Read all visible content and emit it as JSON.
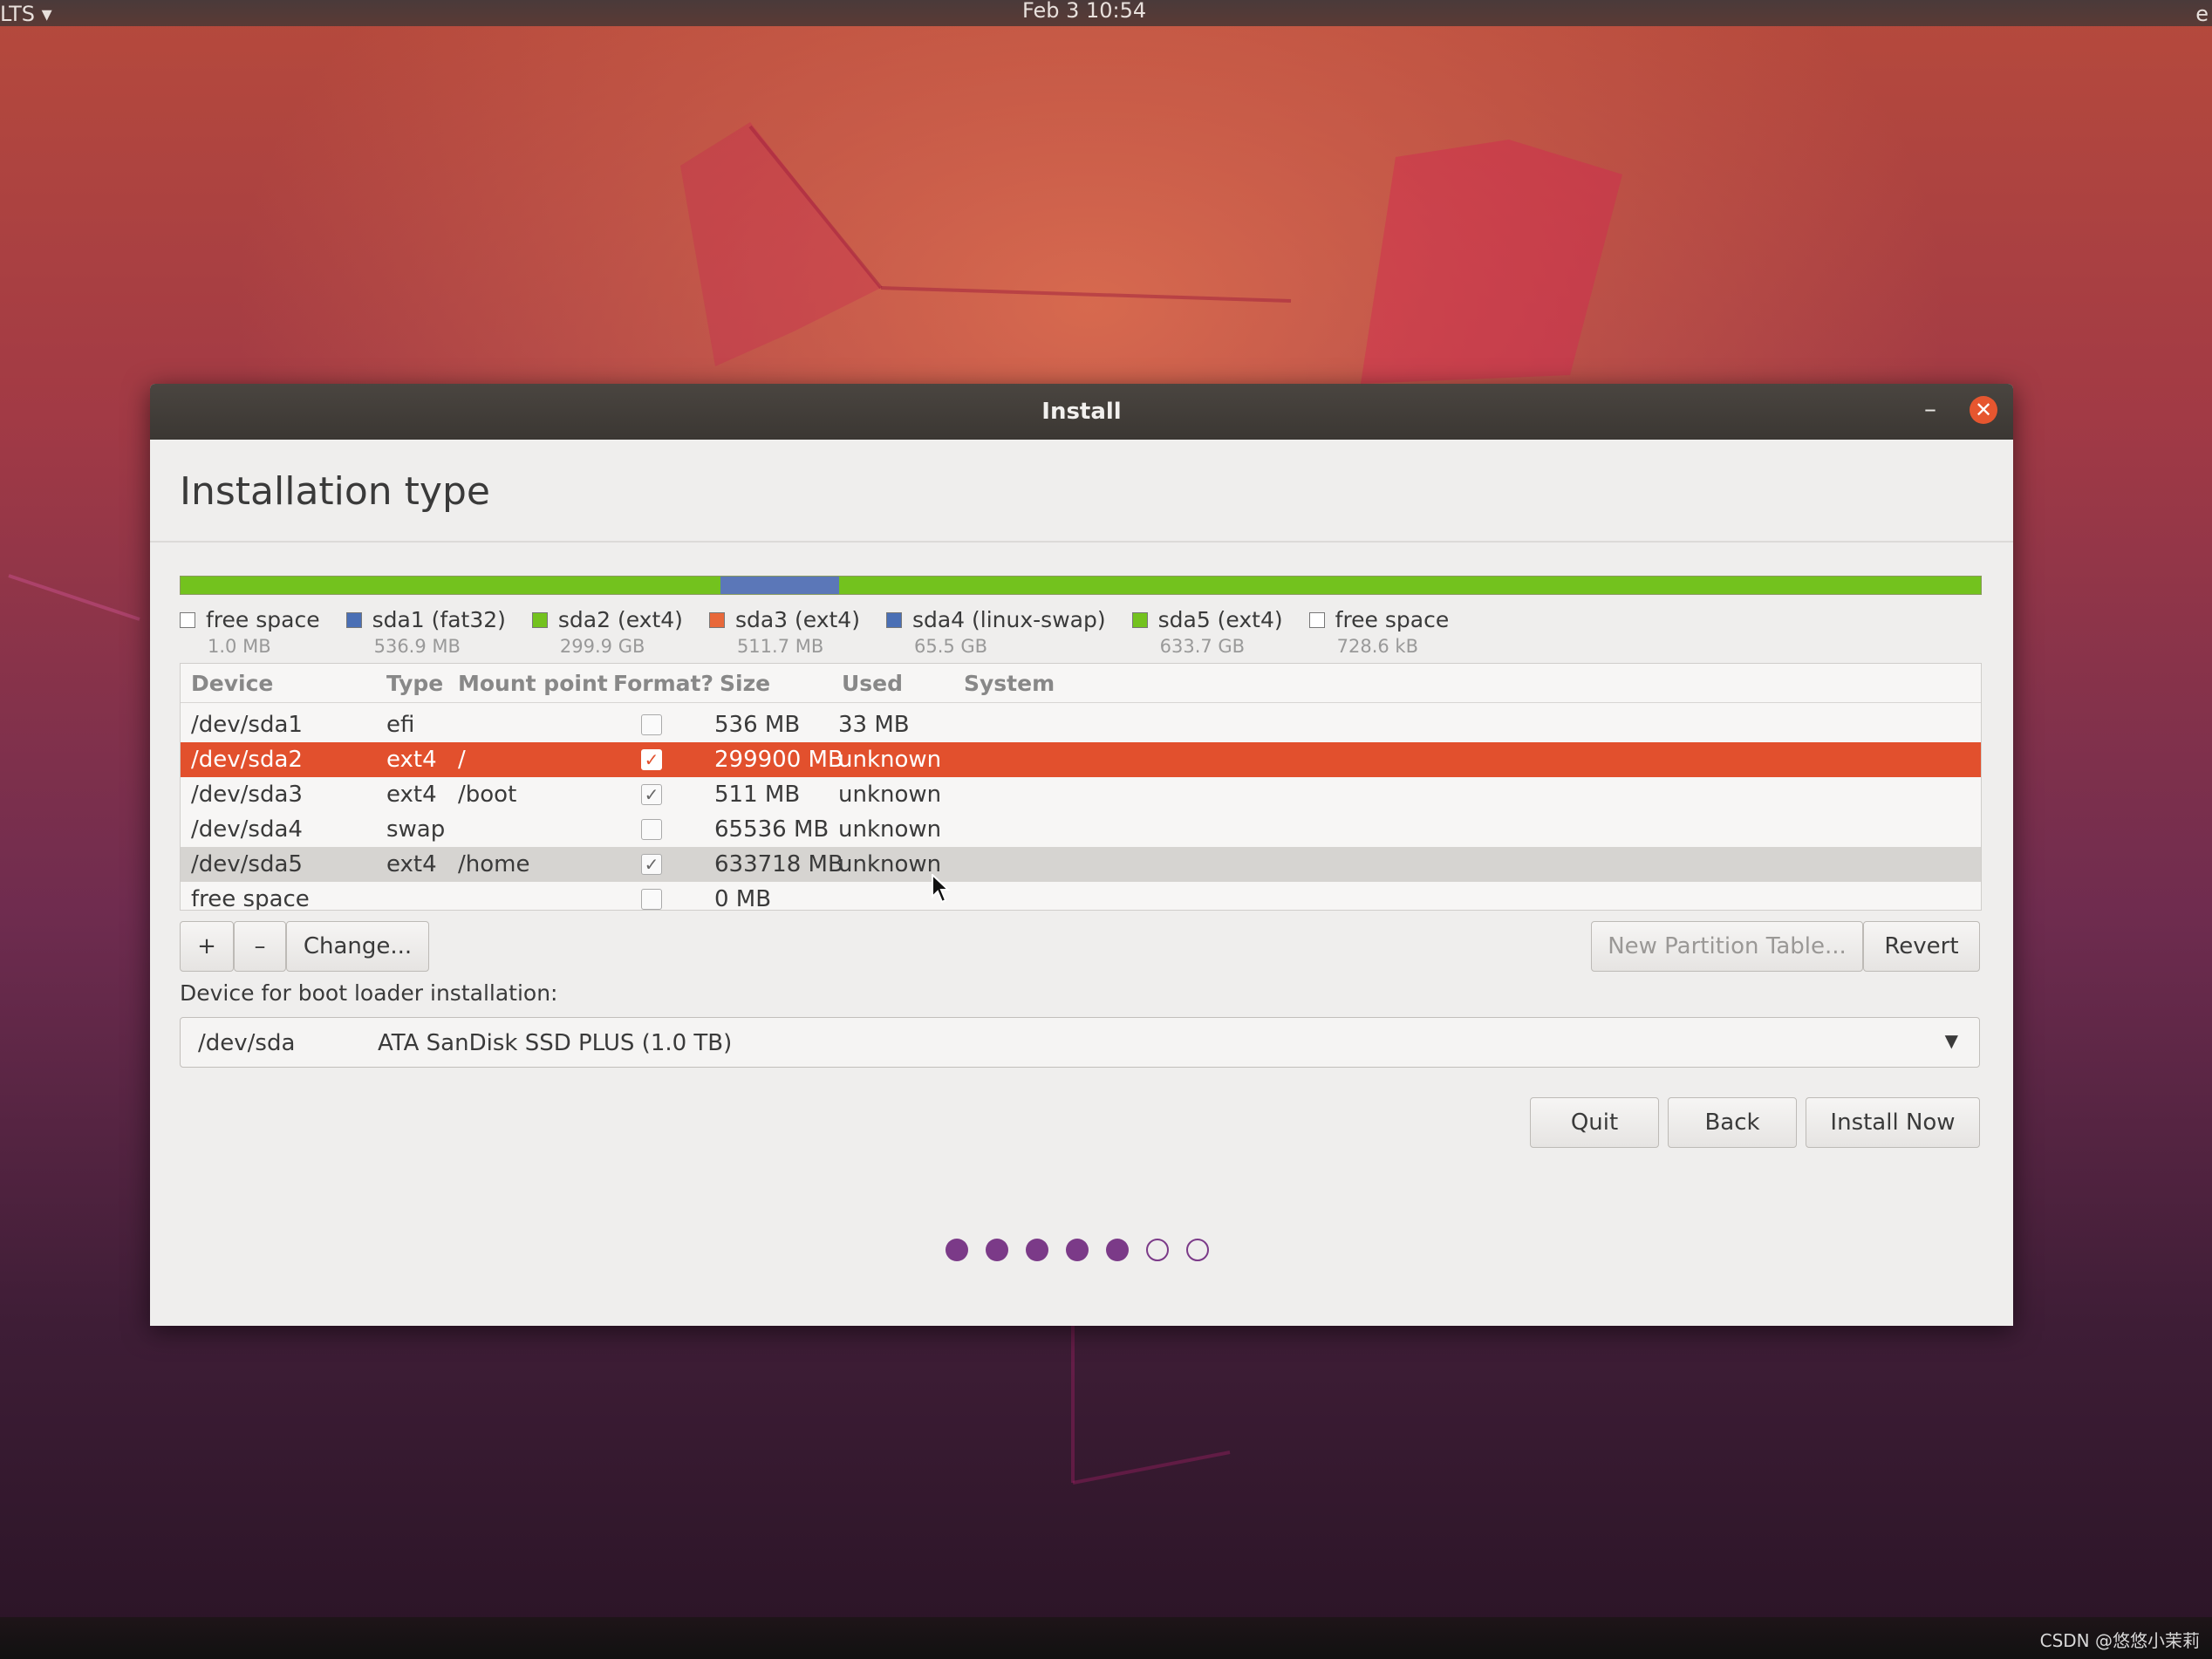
{
  "top_panel": {
    "left_text": "LTS",
    "clock": "Feb 3  10:54",
    "right_text": "e"
  },
  "window": {
    "title": "Install",
    "minimize_glyph": "–",
    "close_glyph": "✕"
  },
  "heading": "Installation type",
  "partition_legend": [
    {
      "label": "free space",
      "size": "1.0 MB",
      "color": "#ffffff"
    },
    {
      "label": "sda1 (fat32)",
      "size": "536.9 MB",
      "color": "#4a6fb5"
    },
    {
      "label": "sda2 (ext4)",
      "size": "299.9 GB",
      "color": "#73c21e"
    },
    {
      "label": "sda3 (ext4)",
      "size": "511.7 MB",
      "color": "#e8683a"
    },
    {
      "label": "sda4 (linux-swap)",
      "size": "65.5 GB",
      "color": "#4a6fb5"
    },
    {
      "label": "sda5 (ext4)",
      "size": "633.7 GB",
      "color": "#73c21e"
    },
    {
      "label": "free space",
      "size": "728.6 kB",
      "color": "#ffffff"
    }
  ],
  "partition_bar": [
    {
      "name": "sda2",
      "fraction": 0.3,
      "color": "#73c21e"
    },
    {
      "name": "sda4",
      "fraction": 0.066,
      "color": "#5b77b8"
    },
    {
      "name": "sda5",
      "fraction": 0.634,
      "color": "#73c21e"
    }
  ],
  "table": {
    "headers": {
      "device": "Device",
      "type": "Type",
      "mount": "Mount point",
      "format": "Format?",
      "size": "Size",
      "used": "Used",
      "system": "System"
    },
    "rows": [
      {
        "device": "/dev/sda1",
        "type": "efi",
        "mount": "",
        "format": false,
        "size": "536 MB",
        "used": "33 MB",
        "system": "",
        "state": "normal"
      },
      {
        "device": "/dev/sda2",
        "type": "ext4",
        "mount": "/",
        "format": true,
        "size": "299900 MB",
        "used": "unknown",
        "system": "",
        "state": "selected"
      },
      {
        "device": "/dev/sda3",
        "type": "ext4",
        "mount": "/boot",
        "format": true,
        "size": "511 MB",
        "used": "unknown",
        "system": "",
        "state": "normal"
      },
      {
        "device": "/dev/sda4",
        "type": "swap",
        "mount": "",
        "format": false,
        "size": "65536 MB",
        "used": "unknown",
        "system": "",
        "state": "normal"
      },
      {
        "device": "/dev/sda5",
        "type": "ext4",
        "mount": "/home",
        "format": true,
        "size": "633718 MB",
        "used": "unknown",
        "system": "",
        "state": "hover"
      },
      {
        "device": "free space",
        "type": "",
        "mount": "",
        "format": false,
        "size": "0 MB",
        "used": "",
        "system": "",
        "state": "normal"
      }
    ]
  },
  "partition_buttons": {
    "add": "+",
    "remove": "–",
    "change": "Change...",
    "new_table": "New Partition Table...",
    "revert": "Revert"
  },
  "boot_loader": {
    "label": "Device for boot loader installation:",
    "device": "/dev/sda",
    "description": "ATA SanDisk SSD PLUS (1.0 TB)"
  },
  "nav_buttons": {
    "quit": "Quit",
    "back": "Back",
    "install": "Install Now"
  },
  "progress": {
    "total": 7,
    "completed": 5
  },
  "watermark": "CSDN @悠悠小茉莉"
}
